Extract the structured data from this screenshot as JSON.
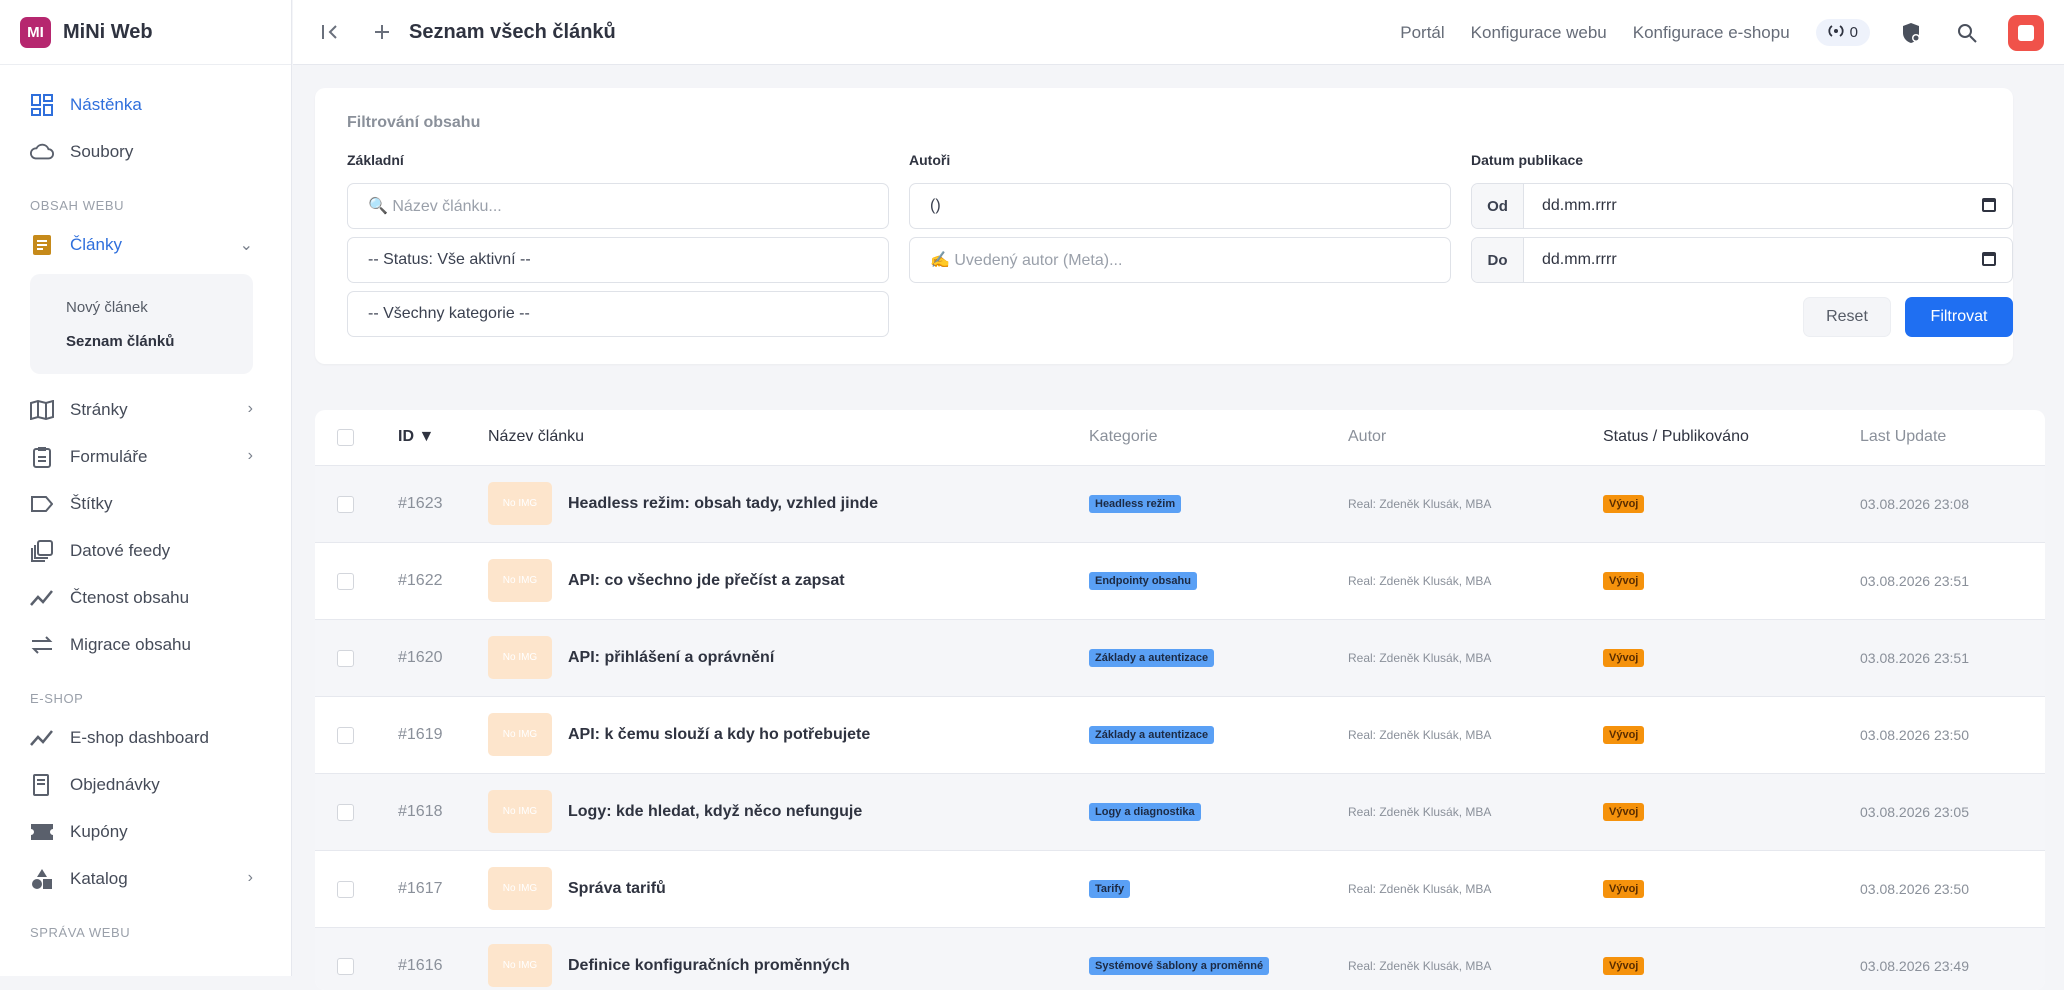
{
  "app": {
    "logo_text": "MI",
    "name": "MiNi Web"
  },
  "sidebar": {
    "top_items": [
      {
        "label": "Nástěnka",
        "icon": "dashboard-icon"
      },
      {
        "label": "Soubory",
        "icon": "cloud-icon"
      }
    ],
    "section_content": "OBSAH WEBU",
    "articles": {
      "label": "Články",
      "icon": "document-icon"
    },
    "submenu": [
      "Nový článek",
      "Seznam článků"
    ],
    "content_items": [
      {
        "label": "Stránky",
        "icon": "book-icon"
      },
      {
        "label": "Formuláře",
        "icon": "clipboard-icon"
      },
      {
        "label": "Štítky",
        "icon": "tag-icon"
      },
      {
        "label": "Datové feedy",
        "icon": "feed-icon"
      },
      {
        "label": "Čtenost obsahu",
        "icon": "chart-icon"
      },
      {
        "label": "Migrace obsahu",
        "icon": "swap-icon"
      }
    ],
    "section_eshop": "E-SHOP",
    "eshop_items": [
      {
        "label": "E-shop dashboard",
        "icon": "chart-icon"
      },
      {
        "label": "Objednávky",
        "icon": "receipt-icon"
      },
      {
        "label": "Kupóny",
        "icon": "ticket-icon"
      },
      {
        "label": "Katalog",
        "icon": "shapes-icon"
      }
    ],
    "section_admin": "SPRÁVA WEBU"
  },
  "topbar": {
    "title": "Seznam všech článků",
    "links": [
      "Portál",
      "Konfigurace webu",
      "Konfigurace e-shopu"
    ],
    "counter": "0"
  },
  "filter": {
    "title": "Filtrování obsahu",
    "col_basic": "Základní",
    "col_authors": "Autoři",
    "col_date": "Datum publikace",
    "search_placeholder": "🔍 Název článku...",
    "status_value": "-- Status: Vše aktivní --",
    "category_value": "-- Všechny kategorie --",
    "author_value": "()",
    "meta_author_placeholder": "✍️ Uvedený autor (Meta)...",
    "from_label": "Od",
    "to_label": "Do",
    "date_placeholder": "dd.mm.rrrr",
    "reset_label": "Reset",
    "submit_label": "Filtrovat"
  },
  "table": {
    "headers": {
      "id": "ID ▼",
      "title": "Název článku",
      "category": "Kategorie",
      "author": "Autor",
      "status": "Status / Publikováno",
      "updated": "Last Update"
    },
    "thumb_text": "No IMG",
    "rows": [
      {
        "id": "#1623",
        "title": "Headless režim: obsah tady, vzhled jinde",
        "category": "Headless režim",
        "author": "Real: Zdeněk Klusák, MBA",
        "status": "Vývoj",
        "updated": "03.08.2026 23:08"
      },
      {
        "id": "#1622",
        "title": "API: co všechno jde přečíst a zapsat",
        "category": "Endpointy obsahu",
        "author": "Real: Zdeněk Klusák, MBA",
        "status": "Vývoj",
        "updated": "03.08.2026 23:51"
      },
      {
        "id": "#1620",
        "title": "API: přihlášení a oprávnění",
        "category": "Základy a autentizace",
        "author": "Real: Zdeněk Klusák, MBA",
        "status": "Vývoj",
        "updated": "03.08.2026 23:51"
      },
      {
        "id": "#1619",
        "title": "API: k čemu slouží a kdy ho potřebujete",
        "category": "Základy a autentizace",
        "author": "Real: Zdeněk Klusák, MBA",
        "status": "Vývoj",
        "updated": "03.08.2026 23:50"
      },
      {
        "id": "#1618",
        "title": "Logy: kde hledat, když něco nefunguje",
        "category": "Logy a diagnostika",
        "author": "Real: Zdeněk Klusák, MBA",
        "status": "Vývoj",
        "updated": "03.08.2026 23:05"
      },
      {
        "id": "#1617",
        "title": "Správa tarifů",
        "category": "Tarify",
        "author": "Real: Zdeněk Klusák, MBA",
        "status": "Vývoj",
        "updated": "03.08.2026 23:50"
      },
      {
        "id": "#1616",
        "title": "Definice konfiguračních proměnných",
        "category": "Systémové šablony a proměnné",
        "author": "Real: Zdeněk Klusák, MBA",
        "status": "Vývoj",
        "updated": "03.08.2026 23:49"
      }
    ]
  },
  "colors": {
    "accent": "#1f6ff2",
    "brand": "#b6276f",
    "status": "#f5920c",
    "category": "#5aa0f5"
  }
}
